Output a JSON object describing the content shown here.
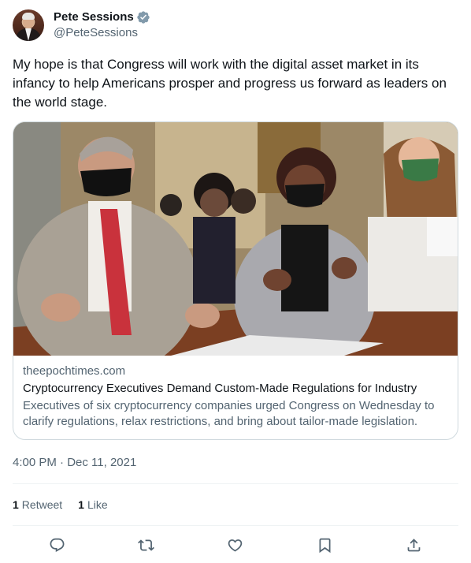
{
  "author": {
    "display_name": "Pete Sessions",
    "handle": "@PeteSessions",
    "verified": true
  },
  "tweet": {
    "text": "My hope is that Congress will work with the digital asset market in its infancy to help Americans prosper and progress us forward as leaders on the world stage."
  },
  "card": {
    "domain": "theepochtimes.com",
    "title": "Cryptocurrency Executives Demand Custom-Made Regulations for Industry",
    "description": "Executives of six cryptocurrency companies urged Congress on Wednesday to clarify regulations, relax restrictions, and bring about tailor-made legislation."
  },
  "timestamp": {
    "time": "4:00 PM",
    "separator": " · ",
    "date": "Dec 11, 2021"
  },
  "stats": {
    "retweets": {
      "count": "1",
      "label": "Retweet"
    },
    "likes": {
      "count": "1",
      "label": "Like"
    }
  },
  "actions": [
    {
      "name": "reply",
      "icon": "reply-icon"
    },
    {
      "name": "retweet",
      "icon": "retweet-icon"
    },
    {
      "name": "like",
      "icon": "heart-icon"
    },
    {
      "name": "bookmark",
      "icon": "bookmark-icon"
    },
    {
      "name": "share",
      "icon": "share-icon"
    }
  ],
  "colors": {
    "text_primary": "#0f1419",
    "text_secondary": "#536471",
    "border": "#cfd9de",
    "verified_blue": "#1d9bf0"
  }
}
